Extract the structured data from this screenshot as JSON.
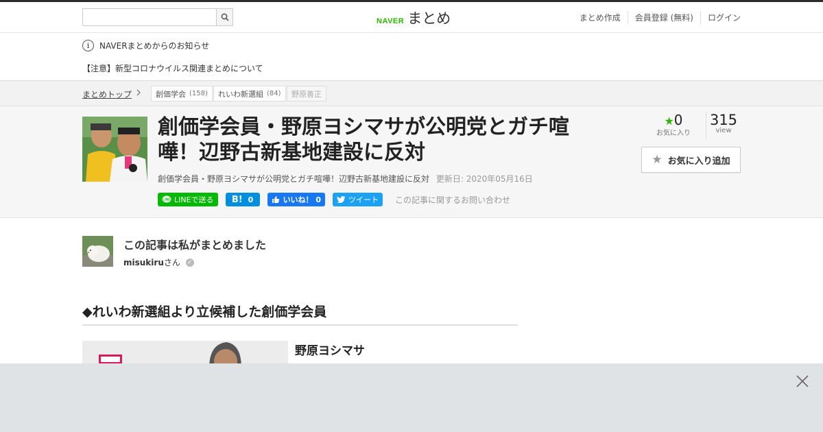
{
  "header": {
    "logo_naver": "NAVER",
    "logo_matome": "まとめ",
    "search_placeholder": "",
    "nav": [
      "まとめ作成",
      "会員登録 (無料)",
      "ログイン"
    ]
  },
  "notice": {
    "title": "NAVERまとめからのお知らせ",
    "item": "【注意】新型コロナウイルス関連まとめについて"
  },
  "breadcrumb": {
    "home": "まとめトップ",
    "tags": [
      {
        "label": "創価学会",
        "count": "(158)"
      },
      {
        "label": "れいわ新選組",
        "count": "(84)"
      },
      {
        "label": "野原善正",
        "count": ""
      }
    ]
  },
  "article": {
    "title": "創価学会員・野原ヨシマサが公明党とガチ喧嘩！辺野古新基地建設に反対",
    "subtitle": "創価学会員・野原ヨシマサが公明党とガチ喧嘩！辺野古新基地建設に反対",
    "updated": "更新日: 2020年05月16日",
    "fav_count": "0",
    "fav_label": "お気に入り",
    "view_count": "315",
    "view_label": "view",
    "fav_button": "お気に入り追加"
  },
  "share": {
    "line": "LINEで送る",
    "hatena": "0",
    "hatena_mark": "B!",
    "fb": "いいね！ 0",
    "tw": "ツイート",
    "contact": "この記事に関するお問い合わせ"
  },
  "author": {
    "heading": "この記事は私がまとめました",
    "name": "misukiru",
    "suffix": "さん"
  },
  "content": {
    "section_title": "◆れいわ新選組より立候補した創価学会員",
    "person_name": "野原ヨシマサ"
  },
  "colors": {
    "accent": "#2db400",
    "line": "#00b900",
    "hatena": "#008fde",
    "facebook": "#1877f2",
    "twitter": "#1da1f2",
    "ad_bg": "#e0e3e6"
  }
}
